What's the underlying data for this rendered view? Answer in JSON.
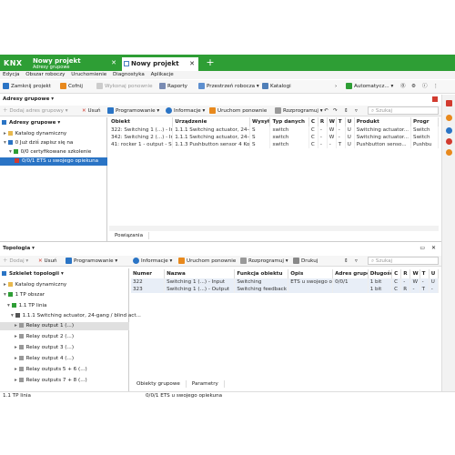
{
  "app": {
    "logo": "KNX",
    "tabs": [
      {
        "title": "Nowy projekt",
        "subtitle": "Adresy grupowe"
      },
      {
        "title": "Nowy projekt"
      }
    ],
    "add_tab": "+"
  },
  "menu": [
    "Edycja",
    "Obszar roboczy",
    "Uruchomienie",
    "Diagnostyka",
    "Aplikacje"
  ],
  "toolbar": {
    "close_project": "Zamknij projekt",
    "undo": "Cofnij",
    "redo": "Wykonaj ponownie",
    "reports": "Raporty",
    "workspace": "Przestrzeń robocza",
    "catalogs": "Katalogi",
    "automatic": "Automatycz...",
    "chevron": "›"
  },
  "group_panel": {
    "title": "Adresy grupowe ▾",
    "actions": {
      "add": "Dodaj adres grupowy",
      "delete": "Usuń",
      "programming": "Programowanie",
      "info": "Informacje",
      "restart": "Uruchom ponownie",
      "reprogram": "Rozprogramuj",
      "search": "Szukaj"
    },
    "tree_header": "Adresy grupowe",
    "tree": [
      "Katalog dynamiczny",
      "0 Już dziś zapisz się na",
      "0/0 certyfikowane szkolenie",
      "0/0/1 ETS u swojego opiekuna"
    ],
    "columns": [
      "Obiekt",
      "Urządzenie",
      "Wysyłaj",
      "Typ danych",
      "C",
      "R",
      "W",
      "T",
      "U",
      "Produkt",
      "Progr"
    ],
    "rows": [
      [
        "322: Switching 1 (...) - Input - Switching",
        "1.1.1 Switching actuator, 24-gang...",
        "S",
        "switch",
        "C",
        "-",
        "W",
        "-",
        "U",
        "Switching actuator...",
        "Switch"
      ],
      [
        "342: Switching 2 (...) - Input - Switching",
        "1.1.1 Switching actuator, 24-gang...",
        "S",
        "switch",
        "C",
        "-",
        "W",
        "-",
        "U",
        "Switching actuator...",
        "Switch"
      ],
      [
        "41: rocker 1 - output - Switching",
        "1.1.3 Pushbutton sensor 4 Kom...",
        "S",
        "switch",
        "C",
        "-",
        "-",
        "T",
        "U",
        "Pushbutton senso...",
        "Pushbu"
      ]
    ],
    "bottom_tab": "Powiązania"
  },
  "topology_panel": {
    "title": "Topologia ▾",
    "actions": {
      "add": "Dodaj",
      "delete": "Usuń",
      "programming": "Programowanie",
      "info": "Informacje",
      "restart": "Uruchom ponownie",
      "reprogram": "Rozprogramuj",
      "print": "Drukuj",
      "search": "Szukaj"
    },
    "tree_header": "Szkielet topologii",
    "tree": [
      "Katalog dynamiczny",
      "1 TP obszar",
      "1.1 TP linia",
      "1.1.1 Switching actuator, 24-gang / blind act...",
      "Relay output 1 (...)",
      "Relay output 2 (...)",
      "Relay output 3 (...)",
      "Relay output 4 (...)",
      "Relay outputs 5 + 6 (...)",
      "Relay outputs 7 + 8 (...)"
    ],
    "columns": [
      "Numer",
      "Nazwa",
      "Funkcja obiektu",
      "Opis",
      "Adres grupowy",
      "Długość",
      "C",
      "R",
      "W",
      "T",
      "U"
    ],
    "rows": [
      [
        "322",
        "Switching 1 (...) - Input",
        "Switching",
        "ETS u swojego o...",
        "0/0/1",
        "1 bit",
        "C",
        "-",
        "W",
        "-",
        "U"
      ],
      [
        "323",
        "Switching 1 (...) - Output",
        "Switching feedback",
        "",
        "",
        "1 bit",
        "C",
        "R",
        "-",
        "T",
        "-"
      ]
    ],
    "bottom_tabs": [
      "Obiekty grupowe",
      "Parametry"
    ]
  },
  "status": {
    "left": "1.1 TP linia",
    "right": "0/0/1 ETS u swojego opiekuna"
  },
  "colors": {
    "brand_green": "#2e9e35",
    "selection_blue": "#2a74c5",
    "icon_orange": "#e8891d",
    "icon_red": "#d23b2f"
  }
}
